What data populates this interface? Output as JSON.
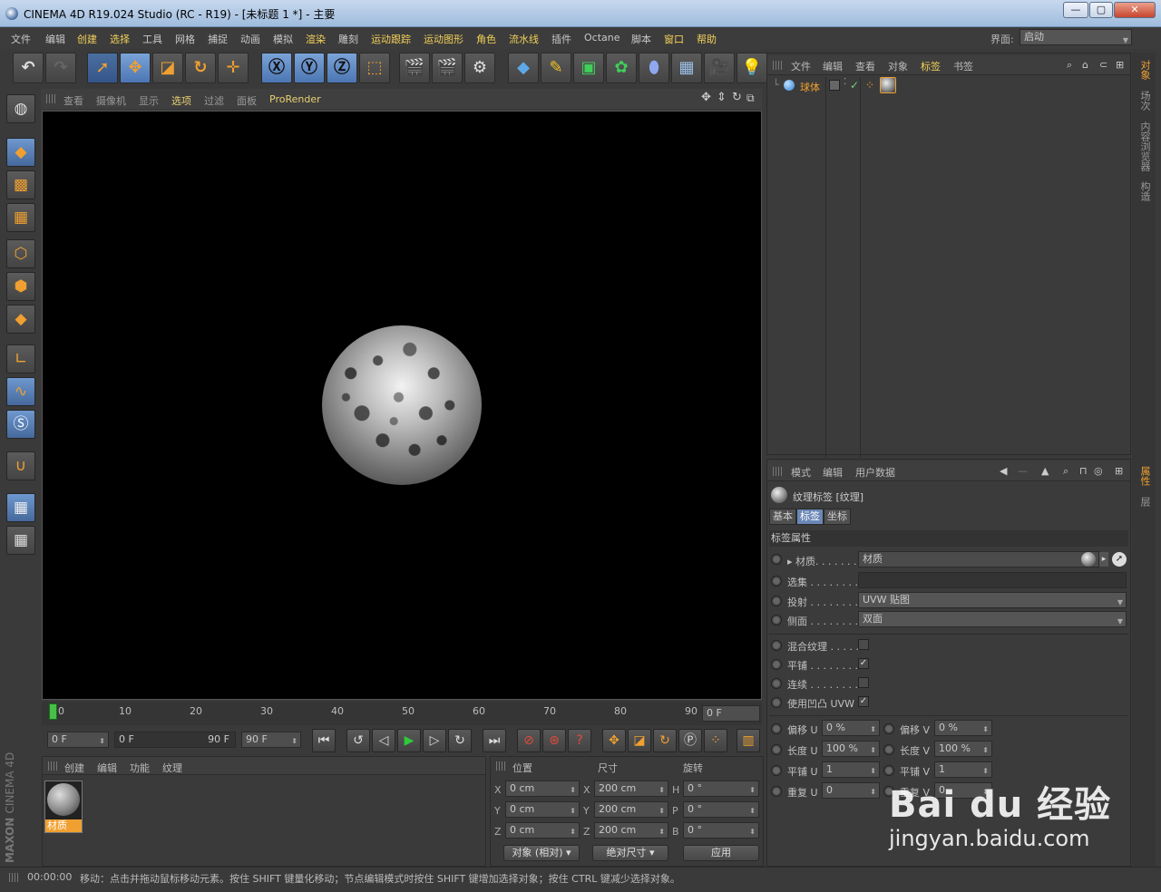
{
  "window": {
    "title": "CINEMA 4D R19.024 Studio (RC - R19) - [未标题 1 *] - 主要",
    "min": "—",
    "max": "▢",
    "close": "✕"
  },
  "menubar": {
    "items": [
      "文件",
      "编辑",
      "创建",
      "选择",
      "工具",
      "网格",
      "捕捉",
      "动画",
      "模拟",
      "渲染",
      "雕刻",
      "运动跟踪",
      "运动图形",
      "角色",
      "流水线",
      "插件",
      "Octane",
      "脚本",
      "窗口",
      "帮助"
    ],
    "layout_label": "界面:",
    "layout_value": "启动"
  },
  "viewport": {
    "menu": [
      "查看",
      "摄像机",
      "显示",
      "选项",
      "过滤",
      "面板",
      "ProRender"
    ]
  },
  "timeline": {
    "ticks": [
      "0",
      "10",
      "20",
      "30",
      "40",
      "50",
      "60",
      "70",
      "80",
      "90"
    ],
    "current_frame": "0 F"
  },
  "transport": {
    "start_field": "0 F",
    "range_start": "0 F",
    "range_end": "90 F",
    "end_field": "90 F"
  },
  "material_panel": {
    "menu": [
      "创建",
      "编辑",
      "功能",
      "纹理"
    ],
    "material_name": "材质"
  },
  "coord_panel": {
    "headers": [
      "位置",
      "尺寸",
      "旋转"
    ],
    "pos": {
      "x": "0 cm",
      "y": "0 cm",
      "z": "0 cm"
    },
    "size": {
      "x": "200 cm",
      "y": "200 cm",
      "z": "200 cm"
    },
    "rot": {
      "h": "0 °",
      "p": "0 °",
      "b": "0 °"
    },
    "axis_labels": {
      "x": "X",
      "y": "Y",
      "z": "Z",
      "h": "H",
      "p": "P",
      "b": "B"
    },
    "mode_select": "对象 (相对)",
    "size_select": "绝对尺寸",
    "apply": "应用"
  },
  "object_manager": {
    "menu": [
      "文件",
      "编辑",
      "查看",
      "对象",
      "标签",
      "书签"
    ],
    "object_name": "球体"
  },
  "attribute_manager": {
    "menu": [
      "模式",
      "编辑",
      "用户数据"
    ],
    "title": "纹理标签 [纹理]",
    "tabs": [
      "基本",
      "标签",
      "坐标"
    ],
    "section": "标签属性",
    "material_label": "材质. . . . . . .",
    "material_value": "材质",
    "selection_label": "选集 . . . . . . . .",
    "projection_label": "投射 . . . . . . . .",
    "projection_value": "UVW 贴图",
    "side_label": "侧面 . . . . . . . .",
    "side_value": "双面",
    "mix_label": "混合纹理 . . . . .",
    "tile_label": "平铺 . . . . . . . .",
    "seamless_label": "连续 . . . . . . . .",
    "bump_uvw_label": "使用凹凸 UVW",
    "offset_u": {
      "label": "偏移 U",
      "value": "0 %"
    },
    "offset_v": {
      "label": "偏移 V",
      "value": "0 %"
    },
    "length_u": {
      "label": "长度 U",
      "value": "100 %"
    },
    "length_v": {
      "label": "长度 V",
      "value": "100 %"
    },
    "tiles_u": {
      "label": "平铺 U",
      "value": "1"
    },
    "tiles_v": {
      "label": "平铺 V",
      "value": "1"
    },
    "repeat_u": {
      "label": "重复 U",
      "value": "0"
    },
    "repeat_v": {
      "label": "重复 V",
      "value": "0"
    }
  },
  "right_tabs": [
    "对象",
    "场次",
    "内容浏览器",
    "构造"
  ],
  "right_tabs_lower": [
    "属性",
    "层"
  ],
  "status": {
    "time": "00:00:00",
    "message": "移动：点击并拖动鼠标移动元素。按住 SHIFT 键量化移动；节点编辑模式时按住 SHIFT 键增加选择对象；按住 CTRL 键减少选择对象。"
  },
  "brand": {
    "maxon": "MAXON",
    "c4d": "CINEMA 4D"
  },
  "watermark": {
    "logo": "Bai du 经验",
    "url": "jingyan.baidu.com"
  },
  "colors": {
    "accent": "#f0a030",
    "highlight_menu": "#f2d058",
    "active_tab": "#6a87b5",
    "viewport_bg": "#000000"
  }
}
